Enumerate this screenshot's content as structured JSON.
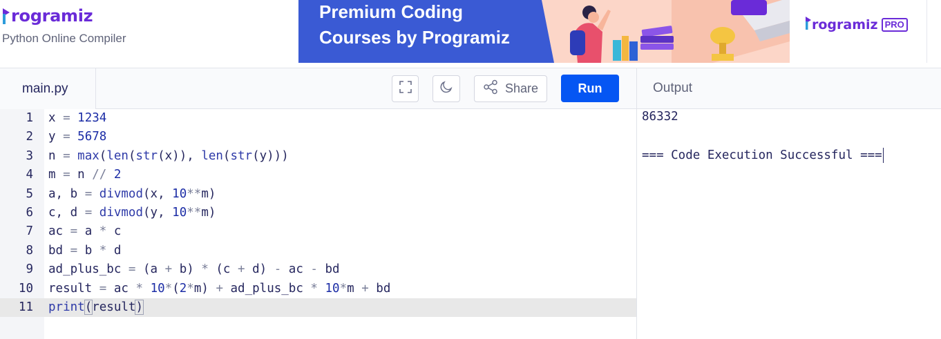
{
  "header": {
    "logo_text": "rogramiz",
    "subtitle": "Python Online Compiler"
  },
  "banner": {
    "line1": "Premium Coding",
    "line2": "Courses by Programiz",
    "logo_text": "rogramiz",
    "pro_badge": "PRO"
  },
  "toolbar": {
    "file_tab": "main.py",
    "share_label": "Share",
    "run_label": "Run"
  },
  "output": {
    "title": "Output",
    "lines": [
      "86332",
      "",
      "=== Code Execution Successful ==="
    ]
  },
  "editor": {
    "active_line": 11,
    "lines": [
      {
        "num": "1",
        "code": "x = 1234"
      },
      {
        "num": "2",
        "code": "y = 5678"
      },
      {
        "num": "3",
        "code": "n = max(len(str(x)), len(str(y)))"
      },
      {
        "num": "4",
        "code": "m = n // 2"
      },
      {
        "num": "5",
        "code": "a, b = divmod(x, 10**m)"
      },
      {
        "num": "6",
        "code": "c, d = divmod(y, 10**m)"
      },
      {
        "num": "7",
        "code": "ac = a * c"
      },
      {
        "num": "8",
        "code": "bd = b * d"
      },
      {
        "num": "9",
        "code": "ad_plus_bc = (a + b) * (c + d) - ac - bd"
      },
      {
        "num": "10",
        "code": "result = ac * 10*(2*m) + ad_plus_bc * 10*m + bd"
      },
      {
        "num": "11",
        "code": "print(result)"
      }
    ]
  },
  "colors": {
    "brand": "#6a2bd8",
    "run_button": "#0556f3",
    "banner_blue": "#3a5ad4",
    "banner_peach": "#fcd6c8"
  },
  "icons": [
    "logo-mark-icon",
    "fullscreen-icon",
    "moon-icon",
    "share-icon"
  ]
}
